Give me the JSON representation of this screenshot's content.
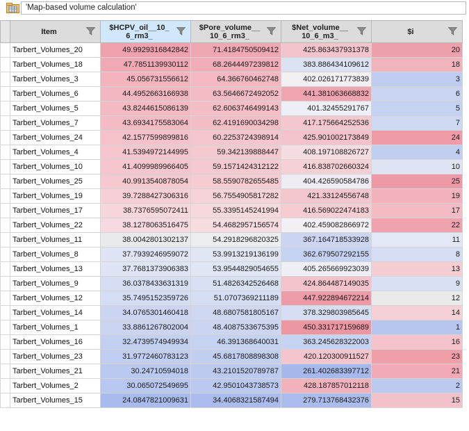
{
  "title": {
    "text": "'Map-based volume calculation'"
  },
  "columns": [
    {
      "label": "Item",
      "selected": false
    },
    {
      "label": "$HCPV_oil__10_\n6_rm3_",
      "selected": true
    },
    {
      "label": "$Pore_volume__\n10_6_rm3_",
      "selected": false
    },
    {
      "label": "$Net_volume__\n10_6_m3_",
      "selected": false
    },
    {
      "label": "$i",
      "selected": false
    }
  ],
  "rows": [
    {
      "item": "Tarbert_Volumes_20",
      "hcpv": "49.9929316842842",
      "pore": "71.4184750509412",
      "net": "425.863437931378",
      "i": "20",
      "c": [
        "#efa1ad",
        "#efa7b2",
        "#f3c4cb",
        "#eda1ad"
      ]
    },
    {
      "item": "Tarbert_Volumes_18",
      "hcpv": "47.7851139930112",
      "pore": "68.2644497239812",
      "net": "383.886434109612",
      "i": "18",
      "c": [
        "#f1aab5",
        "#f1aeb8",
        "#dde2f3",
        "#f1b4bd"
      ]
    },
    {
      "item": "Tarbert_Volumes_3",
      "hcpv": "45.056731556612",
      "pore": "64.366760462748",
      "net": "402.026171773839",
      "i": "3",
      "c": [
        "#f3b4be",
        "#f3b8c1",
        "#f2f0f3",
        "#bfcdf1"
      ]
    },
    {
      "item": "Tarbert_Volumes_6",
      "hcpv": "44.4952663166938",
      "pore": "63.5646672492052",
      "net": "441.381063668832",
      "i": "6",
      "c": [
        "#f3b7c1",
        "#f3bbc4",
        "#efa4b0",
        "#cad5f2"
      ]
    },
    {
      "item": "Tarbert_Volumes_5",
      "hcpv": "43.8244615086139",
      "pore": "62.6063746499143",
      "net": "401.32455291767",
      "i": "5",
      "c": [
        "#f4bac3",
        "#f4bec6",
        "#eef0f8",
        "#c6d2f2"
      ]
    },
    {
      "item": "Tarbert_Volumes_7",
      "hcpv": "43.6934175583064",
      "pore": "62.4191690034298",
      "net": "417.175664252536",
      "i": "7",
      "c": [
        "#f4bbc4",
        "#f4bec6",
        "#f4c8ce",
        "#d0d9f3"
      ]
    },
    {
      "item": "Tarbert_Volumes_24",
      "hcpv": "42.1577599899816",
      "pore": "60.2253724398914",
      "net": "425.901002173849",
      "i": "24",
      "c": [
        "#f5c2ca",
        "#f5c6cd",
        "#f3c2ca",
        "#ef9ba8"
      ]
    },
    {
      "item": "Tarbert_Volumes_4",
      "hcpv": "41.5394972144995",
      "pore": "59.342139888447",
      "net": "408.197108826727",
      "i": "4",
      "c": [
        "#f5c6cd",
        "#f5c9d0",
        "#f6dde1",
        "#c1cff1"
      ]
    },
    {
      "item": "Tarbert_Volumes_10",
      "hcpv": "41.4099989966405",
      "pore": "59.1571424312122",
      "net": "416.838702660324",
      "i": "10",
      "c": [
        "#f5c6cd",
        "#f5c9d0",
        "#f5d0d5",
        "#dfe5f4"
      ]
    },
    {
      "item": "Tarbert_Volumes_25",
      "hcpv": "40.9913540878054",
      "pore": "58.5590782655485",
      "net": "404.426590584786",
      "i": "25",
      "c": [
        "#f6c9d0",
        "#f6ccd2",
        "#f0ecf4",
        "#ee99a6"
      ]
    },
    {
      "item": "Tarbert_Volumes_19",
      "hcpv": "39.7288427306316",
      "pore": "56.7554905817282",
      "net": "421.33124556748",
      "i": "19",
      "c": [
        "#f6d0d6",
        "#f6d3d8",
        "#f4c6cd",
        "#f2b1bb"
      ]
    },
    {
      "item": "Tarbert_Volumes_17",
      "hcpv": "38.7376595072411",
      "pore": "55.3395145241994",
      "net": "416.569022474183",
      "i": "17",
      "c": [
        "#f7d7db",
        "#f7d9dd",
        "#f5cdd3",
        "#f3bcc5"
      ]
    },
    {
      "item": "Tarbert_Volumes_22",
      "hcpv": "38.1278063516475",
      "pore": "54.4682957156574",
      "net": "402.459082866972",
      "i": "22",
      "c": [
        "#f7dadf",
        "#f7dce0",
        "#f2f0f5",
        "#efa3af"
      ]
    },
    {
      "item": "Tarbert_Volumes_11",
      "hcpv": "38.0042801302137",
      "pore": "54.2918296820325",
      "net": "367.164718533928",
      "i": "11",
      "c": [
        "#e9eaeb",
        "#eceef0",
        "#ccd6f2",
        "#e3e8f6"
      ]
    },
    {
      "item": "Tarbert_Volumes_8",
      "hcpv": "37.7939246959072",
      "pore": "53.9913219136199",
      "net": "362.679507292155",
      "i": "8",
      "c": [
        "#dfe5f4",
        "#e1e6f4",
        "#c6d2f2",
        "#d4ddf4"
      ]
    },
    {
      "item": "Tarbert_Volumes_13",
      "hcpv": "37.7681373906383",
      "pore": "53.9544829054655",
      "net": "405.265669923039",
      "i": "13",
      "c": [
        "#dfe5f4",
        "#e1e6f4",
        "#eff0f6",
        "#f5ced4"
      ]
    },
    {
      "item": "Tarbert_Volumes_9",
      "hcpv": "36.0378433631319",
      "pore": "51.4826342526468",
      "net": "424.864487149035",
      "i": "9",
      "c": [
        "#d6def4",
        "#d8e0f4",
        "#f3c2ca",
        "#d9e1f4"
      ]
    },
    {
      "item": "Tarbert_Volumes_12",
      "hcpv": "35.7495152359726",
      "pore": "51.0707369211189",
      "net": "447.922894672214",
      "i": "12",
      "c": [
        "#d4ddf4",
        "#d6def4",
        "#ed9ba8",
        "#eaeaea"
      ]
    },
    {
      "item": "Tarbert_Volumes_14",
      "hcpv": "34.0765301460418",
      "pore": "48.6807581805167",
      "net": "378.329803985645",
      "i": "14",
      "c": [
        "#ccd6f2",
        "#ced8f3",
        "#d6def4",
        "#f5d0d6"
      ]
    },
    {
      "item": "Tarbert_Volumes_1",
      "hcpv": "33.8861267802004",
      "pore": "48.4087533675395",
      "net": "450.331717159689",
      "i": "1",
      "c": [
        "#cbd5f2",
        "#ccd6f2",
        "#ec96a3",
        "#b7c6ef"
      ]
    },
    {
      "item": "Tarbert_Volumes_16",
      "hcpv": "32.4739574949934",
      "pore": "46.391368640031",
      "net": "363.245628322003",
      "i": "16",
      "c": [
        "#c4d0f1",
        "#c6d2f2",
        "#c7d3f2",
        "#f4c3cb"
      ]
    },
    {
      "item": "Tarbert_Volumes_23",
      "hcpv": "31.9772460783123",
      "pore": "45.6817808898308",
      "net": "420.120300911527",
      "i": "23",
      "c": [
        "#c1cef1",
        "#c3cff1",
        "#f4c5cc",
        "#ef9eaa"
      ]
    },
    {
      "item": "Tarbert_Volumes_21",
      "hcpv": "30.24710594018",
      "pore": "43.2101520789787",
      "net": "261.402683397712",
      "i": "21",
      "c": [
        "#bac9f0",
        "#bccaf0",
        "#a7b9ec",
        "#f1aab5"
      ]
    },
    {
      "item": "Tarbert_Volumes_2",
      "hcpv": "30.065072549695",
      "pore": "42.9501043738573",
      "net": "428.187857012118",
      "i": "2",
      "c": [
        "#b9c8f0",
        "#bbc9f0",
        "#f1b2bc",
        "#bccaf0"
      ]
    },
    {
      "item": "Tarbert_Volumes_15",
      "hcpv": "24.0847821009631",
      "pore": "34.4068321587494",
      "net": "279.713768432376",
      "i": "15",
      "c": [
        "#a9bbec",
        "#abbcec",
        "#abbcec",
        "#f3c1c9"
      ]
    }
  ]
}
